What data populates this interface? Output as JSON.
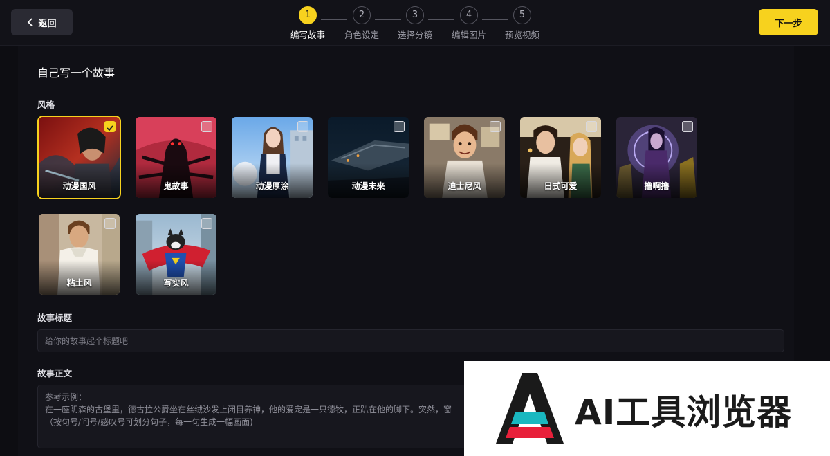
{
  "header": {
    "back_label": "返回",
    "next_label": "下一步",
    "steps": [
      {
        "number": "1",
        "label": "编写故事",
        "active": true
      },
      {
        "number": "2",
        "label": "角色设定",
        "active": false
      },
      {
        "number": "3",
        "label": "选择分镜",
        "active": false
      },
      {
        "number": "4",
        "label": "编辑图片",
        "active": false
      },
      {
        "number": "5",
        "label": "预览视频",
        "active": false
      }
    ]
  },
  "main": {
    "section_title": "自己写一个故事",
    "style_label": "风格",
    "styles": [
      {
        "name": "动漫国风",
        "selected": true
      },
      {
        "name": "鬼故事",
        "selected": false
      },
      {
        "name": "动漫厚涂",
        "selected": false
      },
      {
        "name": "动漫未来",
        "selected": false
      },
      {
        "name": "迪士尼风",
        "selected": false
      },
      {
        "name": "日式可爱",
        "selected": false
      },
      {
        "name": "撸啊撸",
        "selected": false
      },
      {
        "name": "粘土风",
        "selected": false
      },
      {
        "name": "写实风",
        "selected": false
      }
    ],
    "title_label": "故事标题",
    "title_placeholder": "给你的故事起个标题吧",
    "body_label": "故事正文",
    "body_placeholder": {
      "line1": "参考示例：",
      "line2": "在一座阴森的古堡里，德古拉公爵坐在丝绒沙发上闭目养神，他的爱宠是一只德牧，正趴在他的脚下。突然，窗",
      "line3": "（按句号/问号/感叹号可划分句子，每一句生成一幅画面)"
    }
  },
  "watermark": {
    "text": "AI工具浏览器"
  },
  "colors": {
    "accent": "#f7d21e",
    "background": "#0d0d12",
    "panel": "#101016"
  }
}
